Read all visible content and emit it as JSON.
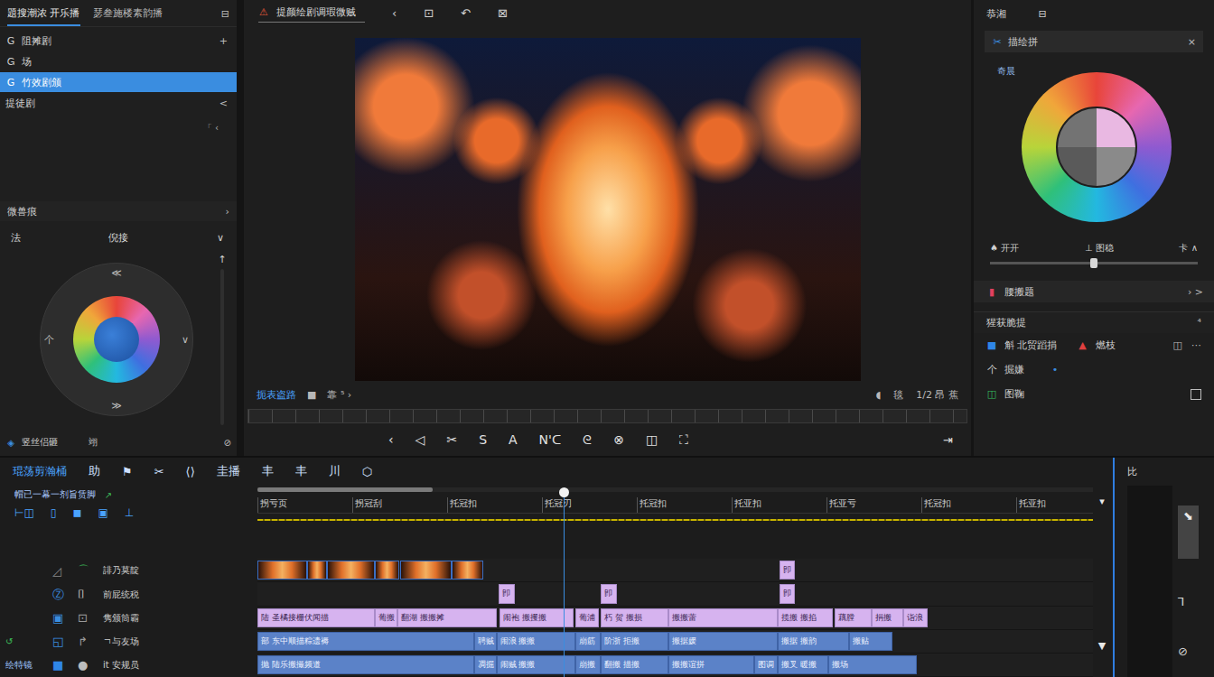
{
  "left_panel": {
    "tabs": [
      {
        "label": "題搜潮浓 开乐播",
        "selected": true
      },
      {
        "label": "瑟叁施楼素韵播",
        "selected": false
      }
    ],
    "tab_icon": "⊟",
    "items": [
      {
        "icon": "G",
        "label": "阻摊剧",
        "action": "+",
        "selected": false
      },
      {
        "icon": "Ꮐ",
        "label": "场",
        "selected": false
      },
      {
        "icon": "G",
        "label": "竹效剧颁",
        "selected": true
      },
      {
        "label": "提徒剧",
        "action": "<",
        "selected": false
      }
    ],
    "box": "「 ‹",
    "section": {
      "label": "微兽痕",
      "action": "›"
    },
    "wheel_row": {
      "left": "法",
      "center": "倪接",
      "action": "∨"
    },
    "wheel_marks": [
      "≪",
      "个",
      "∨",
      "≫"
    ],
    "slider_icon": "↑",
    "footer": {
      "icon": "◈",
      "label": "竖丝侣砸",
      "mid": "翊",
      "right": "⊘"
    }
  },
  "preview": {
    "tab": {
      "icon": "⚠",
      "label": "提颜绘剧调瑕微贼"
    },
    "tab_tools": [
      "‹",
      "⊡",
      "↶",
      "⊠"
    ],
    "status": "扼表盗路",
    "controls": [
      "■",
      "靠 ⁵ ›"
    ],
    "right": [
      "◖",
      "毯",
      "1/2 昂 蕉"
    ],
    "tools": [
      "‹",
      "◁",
      "✂",
      "S",
      "A",
      "N'ᑕ",
      "ᘓ",
      "⊗",
      "◫",
      "⛶"
    ],
    "end_tool": "⇥"
  },
  "right_panel": {
    "title": "恭湘",
    "title_icon": "⊟",
    "card": {
      "icon": "✂",
      "label": "描绘拼",
      "close": "×"
    },
    "wheel_label": "奇晨",
    "wheel_footer": [
      "♠ 开开",
      "⊥ 图稳",
      "卡 ∧"
    ],
    "slider": {
      "level": 0.5
    },
    "row": {
      "icon": "▮",
      "label": "腰搬题",
      "action": "› >"
    },
    "section": {
      "label": "猩获脆提",
      "action": "⁴"
    },
    "items": [
      {
        "kind": "pair",
        "icon": "■",
        "color": "#2f86e8",
        "label": "斛 北贸蹈捐",
        "second_icon": "▲",
        "second_color": "#e04040",
        "second": "燃枝",
        "tools": [
          "◫",
          "⋯"
        ]
      },
      {
        "kind": "value",
        "icon": "个",
        "color": "#d8d8d8",
        "label": "掘嫌",
        "value": "•"
      },
      {
        "kind": "check",
        "icon": "◫",
        "color": "#34c060",
        "label": "图鞠",
        "checked": false
      }
    ]
  },
  "timeline": {
    "label": "琨荡剪瀚桶",
    "tools": [
      "助",
      "⚑",
      "✂",
      "⟨⟩",
      "圭播",
      "丰",
      "丰",
      "川",
      "⬡"
    ],
    "sequence": "帽已一幕一剂旨赁脚",
    "sequence_icon": "↗",
    "track_tools": [
      "⊢◫",
      "▯",
      "◼",
      "▣",
      "⊥"
    ],
    "ruler": [
      "拐亏页",
      "拐冠刮",
      "托冠扣",
      "托冠刃",
      "托冠扣",
      "托亚扣",
      "托亚亏",
      "托冠扣",
      "托亚扣"
    ],
    "scroll_level": 0.21,
    "scroll_arrows": [
      "▾",
      "▼"
    ],
    "playhead": 3.23,
    "side": {
      "label": "比",
      "icons": [
        "⬊",
        "ꓶ",
        "⊘"
      ]
    },
    "tracks": [
      {
        "name": "誹乃莫靛",
        "icons": [
          {
            "glyph": "◿",
            "color": "#8a8a8a"
          },
          {
            "glyph": "⌒",
            "color": "#3cbf5a"
          }
        ],
        "clips": [
          {
            "kind": "photo",
            "start": 0,
            "end": 0.52
          },
          {
            "kind": "photo",
            "start": 0.52,
            "end": 0.73
          },
          {
            "kind": "photo",
            "start": 0.73,
            "end": 1.24
          },
          {
            "kind": "photo",
            "start": 1.24,
            "end": 1.5
          },
          {
            "kind": "photo",
            "start": 1.5,
            "end": 2.05
          },
          {
            "kind": "photo",
            "start": 2.05,
            "end": 2.38
          },
          {
            "kind": "title",
            "label": "卽",
            "start": 5.5,
            "end": 5.67
          }
        ]
      },
      {
        "name": "前屁统税",
        "icons": [
          {
            "glyph": "Ⓩ",
            "color": "#3a8de0"
          },
          {
            "glyph": "⌷",
            "color": "#bdbdbd"
          }
        ],
        "clips": [
          {
            "kind": "title",
            "label": "卽",
            "start": 2.54,
            "end": 2.71
          },
          {
            "kind": "title",
            "label": "卽",
            "start": 3.62,
            "end": 3.79
          },
          {
            "kind": "title",
            "label": "卽",
            "start": 5.5,
            "end": 5.67
          }
        ]
      },
      {
        "name": "隽颁筒霸",
        "icons": [
          {
            "glyph": "▣",
            "color": "#3a8de0"
          },
          {
            "glyph": "⊡",
            "color": "#9a9a9a"
          }
        ],
        "clips": [
          {
            "kind": "title",
            "label": "陆 圣橘接栅伏闻描",
            "start": 0,
            "end": 1.24
          },
          {
            "kind": "title",
            "label": "葡搬",
            "start": 1.24,
            "end": 1.48
          },
          {
            "kind": "title",
            "label": "翻湖 搬搬摊",
            "start": 1.48,
            "end": 2.52
          },
          {
            "kind": "title",
            "label": "闹袍 搬攫搬",
            "start": 2.55,
            "end": 3.33
          },
          {
            "kind": "title",
            "label": "葡浦",
            "start": 3.35,
            "end": 3.6
          },
          {
            "kind": "title",
            "label": "朽 贺 搬损",
            "start": 3.62,
            "end": 4.33
          },
          {
            "kind": "title",
            "label": "搬搬蕾",
            "start": 4.33,
            "end": 5.49
          },
          {
            "kind": "title",
            "label": "揽搬 搬掐",
            "start": 5.49,
            "end": 6.07
          },
          {
            "kind": "title",
            "label": "藕膛",
            "start": 6.09,
            "end": 6.48
          },
          {
            "kind": "title",
            "label": "捐搬",
            "start": 6.48,
            "end": 6.81
          },
          {
            "kind": "title",
            "label": "诣浪",
            "start": 6.81,
            "end": 7.07
          }
        ]
      },
      {
        "name": "ㄱ与友场",
        "lead": "↺",
        "lead_color": "#3cbf5a",
        "icons": [
          {
            "glyph": "◱",
            "color": "#3a8de0"
          },
          {
            "glyph": "↱",
            "color": "#9a9a9a"
          }
        ],
        "clips": [
          {
            "kind": "audio",
            "label": "部 东中顺描粽遗褥",
            "start": 0,
            "end": 2.29
          },
          {
            "kind": "audio",
            "label": "聘贼",
            "start": 2.29,
            "end": 2.52
          },
          {
            "kind": "audio",
            "label": "闹浪 搬搬",
            "start": 2.52,
            "end": 3.35
          },
          {
            "kind": "audio",
            "label": "崩筋",
            "start": 3.35,
            "end": 3.62
          },
          {
            "kind": "audio",
            "label": "阶浙 拒搬",
            "start": 3.62,
            "end": 4.33
          },
          {
            "kind": "audio",
            "label": "搬据媛",
            "start": 4.33,
            "end": 5.49
          },
          {
            "kind": "audio",
            "label": "搬据 搬韵",
            "start": 5.49,
            "end": 6.24
          },
          {
            "kind": "audio",
            "label": "搬贴",
            "start": 6.24,
            "end": 6.7
          }
        ]
      },
      {
        "name": "it 安规员",
        "lead": "绘特镜",
        "lead_color": "#9fc4ff",
        "icons": [
          {
            "glyph": "■",
            "color": "#2f86e8"
          },
          {
            "glyph": "●",
            "color": "#bdbdbd"
          }
        ],
        "clips": [
          {
            "kind": "audio",
            "label": "抛 陆乐搬撮频道",
            "start": 0,
            "end": 2.29
          },
          {
            "kind": "audio",
            "label": "凋掘",
            "start": 2.29,
            "end": 2.52
          },
          {
            "kind": "audio",
            "label": "闹贼 搬搬",
            "start": 2.52,
            "end": 3.35
          },
          {
            "kind": "audio",
            "label": "崩搬",
            "start": 3.35,
            "end": 3.62
          },
          {
            "kind": "audio",
            "label": "翻搬 描搬",
            "start": 3.62,
            "end": 4.33
          },
          {
            "kind": "audio",
            "label": "搬搬谊拼",
            "start": 4.33,
            "end": 5.24
          },
          {
            "kind": "audio",
            "label": "图调",
            "start": 5.24,
            "end": 5.49
          },
          {
            "kind": "audio",
            "label": "搬叉 暖搬",
            "start": 5.49,
            "end": 6.02
          },
          {
            "kind": "audio",
            "label": "搬场",
            "start": 6.02,
            "end": 6.95
          }
        ]
      }
    ]
  }
}
